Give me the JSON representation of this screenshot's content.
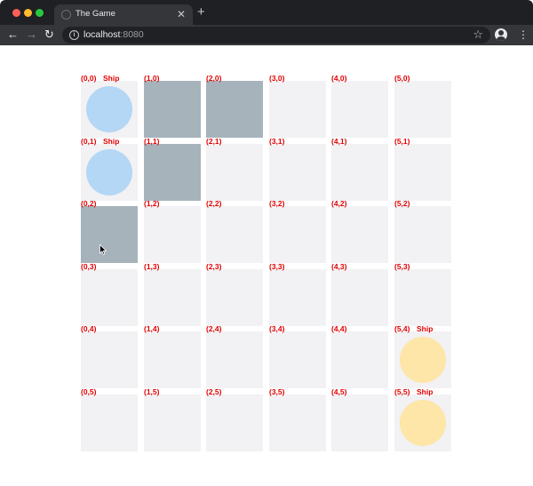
{
  "browser": {
    "tab_title": "The Game",
    "tab_close": "✕",
    "new_tab": "+",
    "url_host": "localhost",
    "url_port": ":8080",
    "info_glyph": "i"
  },
  "board": {
    "cols": 6,
    "rows": 6,
    "ship_label": "Ship",
    "selected_cells": [
      [
        1,
        0
      ],
      [
        2,
        0
      ],
      [
        1,
        1
      ],
      [
        0,
        2
      ]
    ],
    "ships": [
      {
        "col": 0,
        "row": 0,
        "color": "#b3d7f5"
      },
      {
        "col": 0,
        "row": 1,
        "color": "#b3d7f5"
      },
      {
        "col": 5,
        "row": 4,
        "color": "#fde6a8"
      },
      {
        "col": 5,
        "row": 5,
        "color": "#fde6a8"
      }
    ],
    "colors": {
      "cell": "#f2f1f3",
      "selected": "#a7b3bb",
      "label": "#e00000",
      "player_ship": "#b3d7f5",
      "enemy_ship": "#fde6a8"
    }
  }
}
